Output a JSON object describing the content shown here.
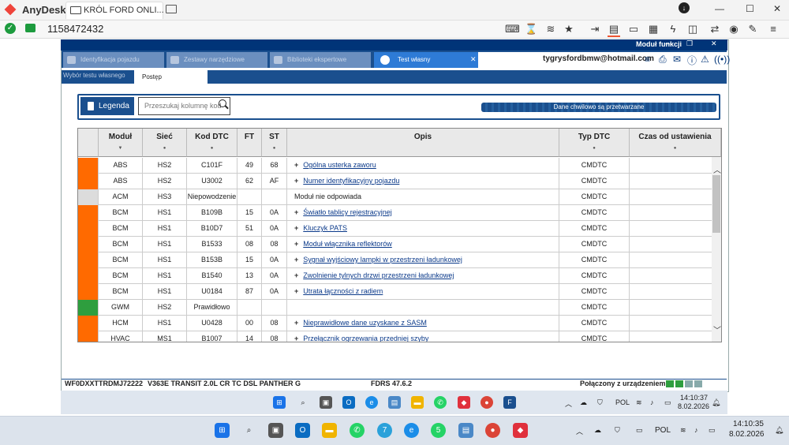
{
  "anydesk": {
    "app_name": "AnyDesk",
    "tab_title": "KRÓL FORD ONLI...",
    "session_id": "1158472432",
    "window_controls": {
      "min": "—",
      "max": "☐",
      "close": "✕"
    },
    "toolbar_icons": [
      "keyboard-icon",
      "hourglass-icon",
      "layers-icon",
      "star-icon",
      "file-transfer-icon",
      "chat-icon",
      "monitor-icon",
      "clipboard-icon",
      "lightning-icon",
      "privacy-icon",
      "record-icon",
      "pen-icon",
      "more-icon"
    ]
  },
  "fdrs": {
    "title_fragment": "Moduł funkcji",
    "tabs": [
      {
        "label": "Identyfikacja pojazdu"
      },
      {
        "label": "Zestawy narzędziowe"
      },
      {
        "label": "Biblioteki ekspertowe"
      }
    ],
    "active_tab": "Test własny",
    "user_email": "tygrysfordbmw@hotmail.com",
    "subtabs": {
      "inactive": "Wybór testu własnego",
      "active": "Postęp"
    },
    "legend_label": "Legenda",
    "search_placeholder": "Przeszukaj kolumnę kod",
    "busy_text": "Dane chwilowo są przetwarzane",
    "columns": [
      "Moduł",
      "Sieć",
      "Kod DTC",
      "FT",
      "ST",
      "Opis",
      "Typ DTC",
      "Czas od ustawienia"
    ],
    "rows": [
      {
        "status": "#ff6a00",
        "module": "ABS",
        "net": "HS2",
        "dtc": "C101F",
        "ft": "49",
        "st": "68",
        "desc": "Ogólna usterka zaworu",
        "plus": "+",
        "type": "CMDTC",
        "time": ""
      },
      {
        "status": "#ff6a00",
        "module": "ABS",
        "net": "HS2",
        "dtc": "U3002",
        "ft": "62",
        "st": "AF",
        "desc": "Numer identyfikacyjny pojazdu",
        "plus": "+",
        "type": "CMDTC",
        "time": ""
      },
      {
        "status": "#dcdcdc",
        "module": "ACM",
        "net": "HS3",
        "dtc": "Niepowodzenie",
        "ft": "",
        "st": "",
        "desc": "Moduł nie odpowiada",
        "plus": "",
        "type": "CMDTC",
        "time": ""
      },
      {
        "status": "#ff6a00",
        "module": "BCM",
        "net": "HS1",
        "dtc": "B109B",
        "ft": "15",
        "st": "0A",
        "desc": "Światło tablicy rejestracyjnej",
        "plus": "+",
        "type": "CMDTC",
        "time": ""
      },
      {
        "status": "#ff6a00",
        "module": "BCM",
        "net": "HS1",
        "dtc": "B10D7",
        "ft": "51",
        "st": "0A",
        "desc": "Kluczyk PATS",
        "plus": "+",
        "type": "CMDTC",
        "time": ""
      },
      {
        "status": "#ff6a00",
        "module": "BCM",
        "net": "HS1",
        "dtc": "B1533",
        "ft": "08",
        "st": "08",
        "desc": "Moduł włącznika reflektorów",
        "plus": "+",
        "type": "CMDTC",
        "time": ""
      },
      {
        "status": "#ff6a00",
        "module": "BCM",
        "net": "HS1",
        "dtc": "B153B",
        "ft": "15",
        "st": "0A",
        "desc": "Sygnał wyjściowy lampki w przestrzeni ładunkowej",
        "plus": "+",
        "type": "CMDTC",
        "time": ""
      },
      {
        "status": "#ff6a00",
        "module": "BCM",
        "net": "HS1",
        "dtc": "B1540",
        "ft": "13",
        "st": "0A",
        "desc": "Zwolnienie tylnych drzwi przestrzeni ładunkowej",
        "plus": "+",
        "type": "CMDTC",
        "time": ""
      },
      {
        "status": "#ff6a00",
        "module": "BCM",
        "net": "HS1",
        "dtc": "U0184",
        "ft": "87",
        "st": "0A",
        "desc": "Utrata łączności z radiem",
        "plus": "+",
        "type": "CMDTC",
        "time": ""
      },
      {
        "status": "#2e9e3e",
        "module": "GWM",
        "net": "HS2",
        "dtc": "Prawidłowo",
        "ft": "",
        "st": "",
        "desc": "",
        "plus": "",
        "type": "CMDTC",
        "time": ""
      },
      {
        "status": "#ff6a00",
        "module": "HCM",
        "net": "HS1",
        "dtc": "U0428",
        "ft": "00",
        "st": "08",
        "desc": "Nieprawidłowe dane uzyskane z SASM",
        "plus": "+",
        "type": "CMDTC",
        "time": ""
      },
      {
        "status": "#ff6a00",
        "module": "HVAC",
        "net": "MS1",
        "dtc": "B1007",
        "ft": "14",
        "st": "08",
        "desc": "Przełącznik ogrzewania przedniej szyby",
        "plus": "+",
        "type": "CMDTC",
        "time": ""
      }
    ],
    "status_bar": {
      "vin": "WF0DXXTTRDMJ72222",
      "vehicle": "V363E TRANSIT 2.0L CR TC DSL PANTHER G",
      "version": "FDRS 47.6.2",
      "connection": "Połączony z urządzeniem"
    }
  },
  "remote_tray": {
    "lang": "POL",
    "time": "14:10:37",
    "date": "8.02.2026"
  },
  "local_tray": {
    "lang": "POL",
    "time": "14:10:35",
    "date": "8.02.2026",
    "whatsapp_badge": "7",
    "whatsapp2_badge": "5"
  }
}
